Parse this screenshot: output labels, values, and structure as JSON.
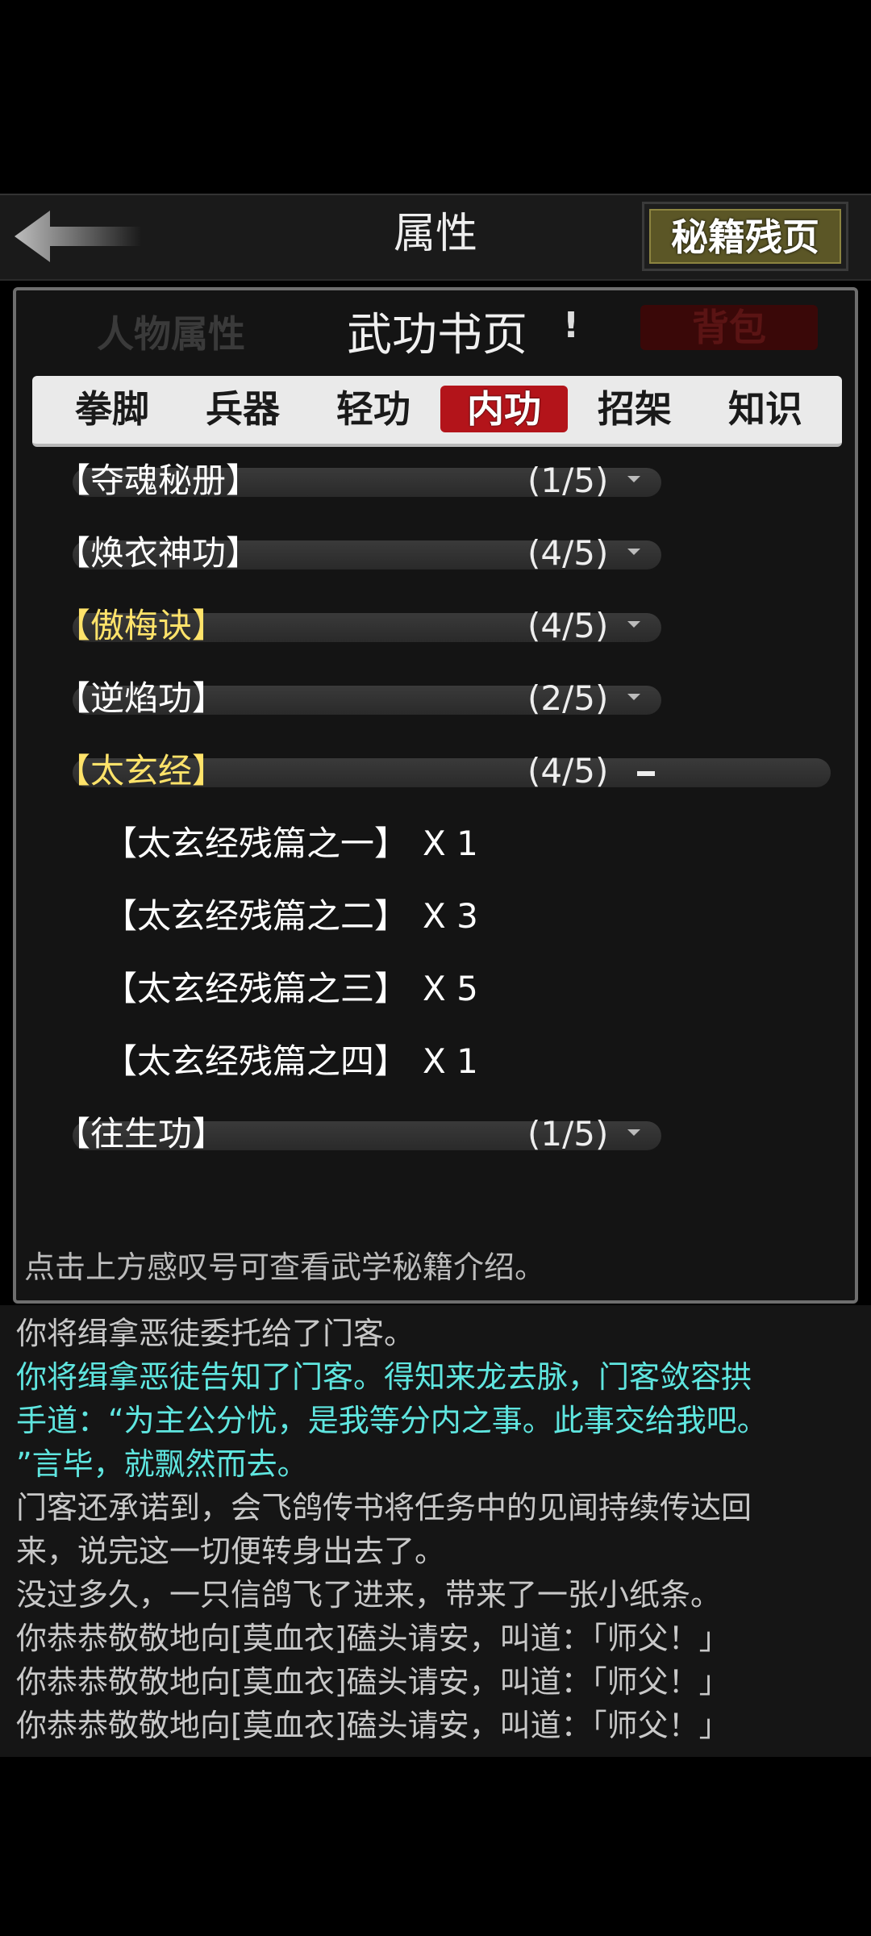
{
  "header": {
    "title": "属性",
    "secret_button": "秘籍残页"
  },
  "panel": {
    "char_attr_label": "人物属性",
    "book_title": "武功书页",
    "book_excl": "!",
    "bag_label": "背包",
    "tabs": [
      {
        "label": "拳脚"
      },
      {
        "label": "兵器"
      },
      {
        "label": "轻功"
      },
      {
        "label": "内功",
        "active": true
      },
      {
        "label": "招架"
      },
      {
        "label": "知识"
      }
    ],
    "books": [
      {
        "name": "【夺魂秘册】",
        "progress": "(1/5)",
        "color": "#ffffff",
        "expanded": false
      },
      {
        "name": "【焕衣神功】",
        "progress": "(4/5)",
        "color": "#ffffff",
        "expanded": false
      },
      {
        "name": "【傲梅诀】",
        "progress": "(4/5)",
        "color": "#ffe36a",
        "expanded": false
      },
      {
        "name": "【逆焰功】",
        "progress": "(2/5)",
        "color": "#ffffff",
        "expanded": false
      },
      {
        "name": "【太玄经】",
        "progress": "(4/5)",
        "color": "#ffe36a",
        "expanded": true
      },
      {
        "name": "【往生功】",
        "progress": "(1/5)",
        "color": "#ffffff",
        "expanded": false
      }
    ],
    "fragments": [
      {
        "name": "【太玄经残篇之一】",
        "qty": "X 1"
      },
      {
        "name": "【太玄经残篇之二】",
        "qty": "X 3"
      },
      {
        "name": "【太玄经残篇之三】",
        "qty": "X 5"
      },
      {
        "name": "【太玄经残篇之四】",
        "qty": "X 1"
      }
    ],
    "hint": "点击上方感叹号可查看武学秘籍介绍。"
  },
  "log": [
    {
      "text": "你将缉拿恶徒委托给了门客。",
      "color": "grey"
    },
    {
      "text": "你将缉拿恶徒告知了门客。得知来龙去脉，门客敛容拱",
      "color": "cyan"
    },
    {
      "text": "手道：“为主公分忧，是我等分内之事。此事交给我吧。",
      "color": "cyan"
    },
    {
      "text": "”言毕，就飘然而去。",
      "color": "cyan"
    },
    {
      "text": "门客还承诺到，会飞鸽传书将任务中的见闻持续传达回",
      "color": "grey"
    },
    {
      "text": "来，说完这一切便转身出去了。",
      "color": "grey"
    },
    {
      "text": "没过多久，一只信鸽飞了进来，带来了一张小纸条。",
      "color": "grey"
    },
    {
      "text": "你恭恭敬敬地向[莫血衣]磕头请安，叫道：「师父！」",
      "color": "grey"
    },
    {
      "text": "你恭恭敬敬地向[莫血衣]磕头请安，叫道：「师父！」",
      "color": "grey"
    },
    {
      "text": "你恭恭敬敬地向[莫血衣]磕头请安，叫道：「师父！」",
      "color": "grey"
    }
  ]
}
